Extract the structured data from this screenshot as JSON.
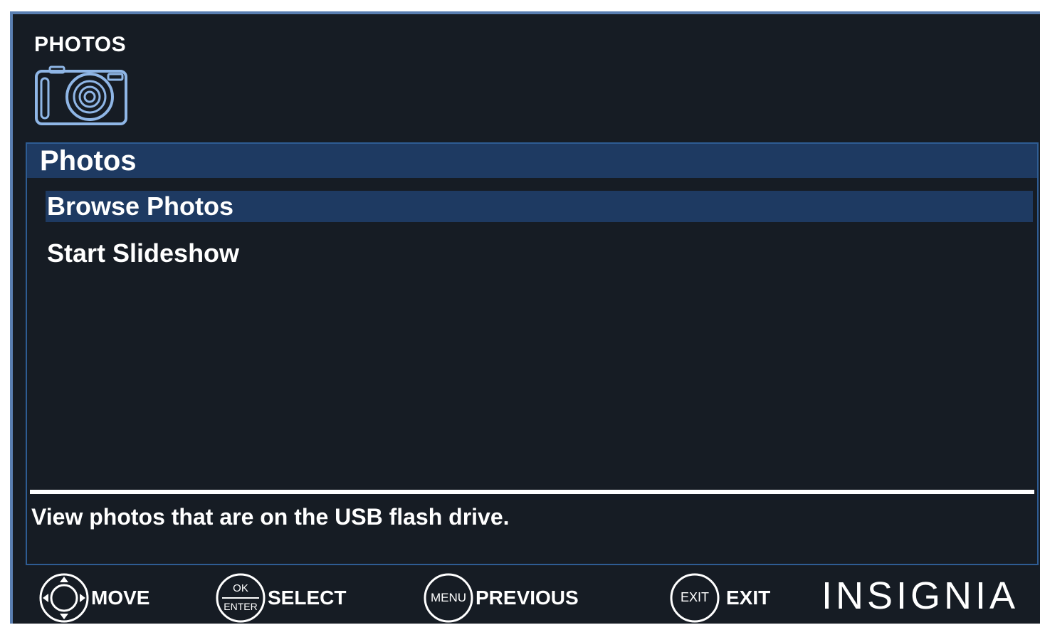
{
  "header": {
    "title": "PHOTOS",
    "icon": "camera-icon"
  },
  "panel": {
    "title": "Photos",
    "items": [
      {
        "label": "Browse Photos",
        "selected": true
      },
      {
        "label": "Start Slideshow",
        "selected": false
      }
    ],
    "description": "View photos that are on the USB flash drive."
  },
  "footer": {
    "buttons": [
      {
        "icon": "dpad-icon",
        "label": "MOVE"
      },
      {
        "icon": "ok-enter-icon",
        "icon_top": "OK",
        "icon_bottom": "ENTER",
        "label": "SELECT"
      },
      {
        "icon": "menu-icon",
        "icon_text": "MENU",
        "label": "PREVIOUS"
      },
      {
        "icon": "exit-icon",
        "icon_text": "EXIT",
        "label": "EXIT"
      }
    ],
    "brand": "INSIGNIA"
  },
  "colors": {
    "background": "#161c24",
    "highlight": "#1e3a62",
    "frame": "#5a7fb2",
    "text": "#ffffff"
  }
}
